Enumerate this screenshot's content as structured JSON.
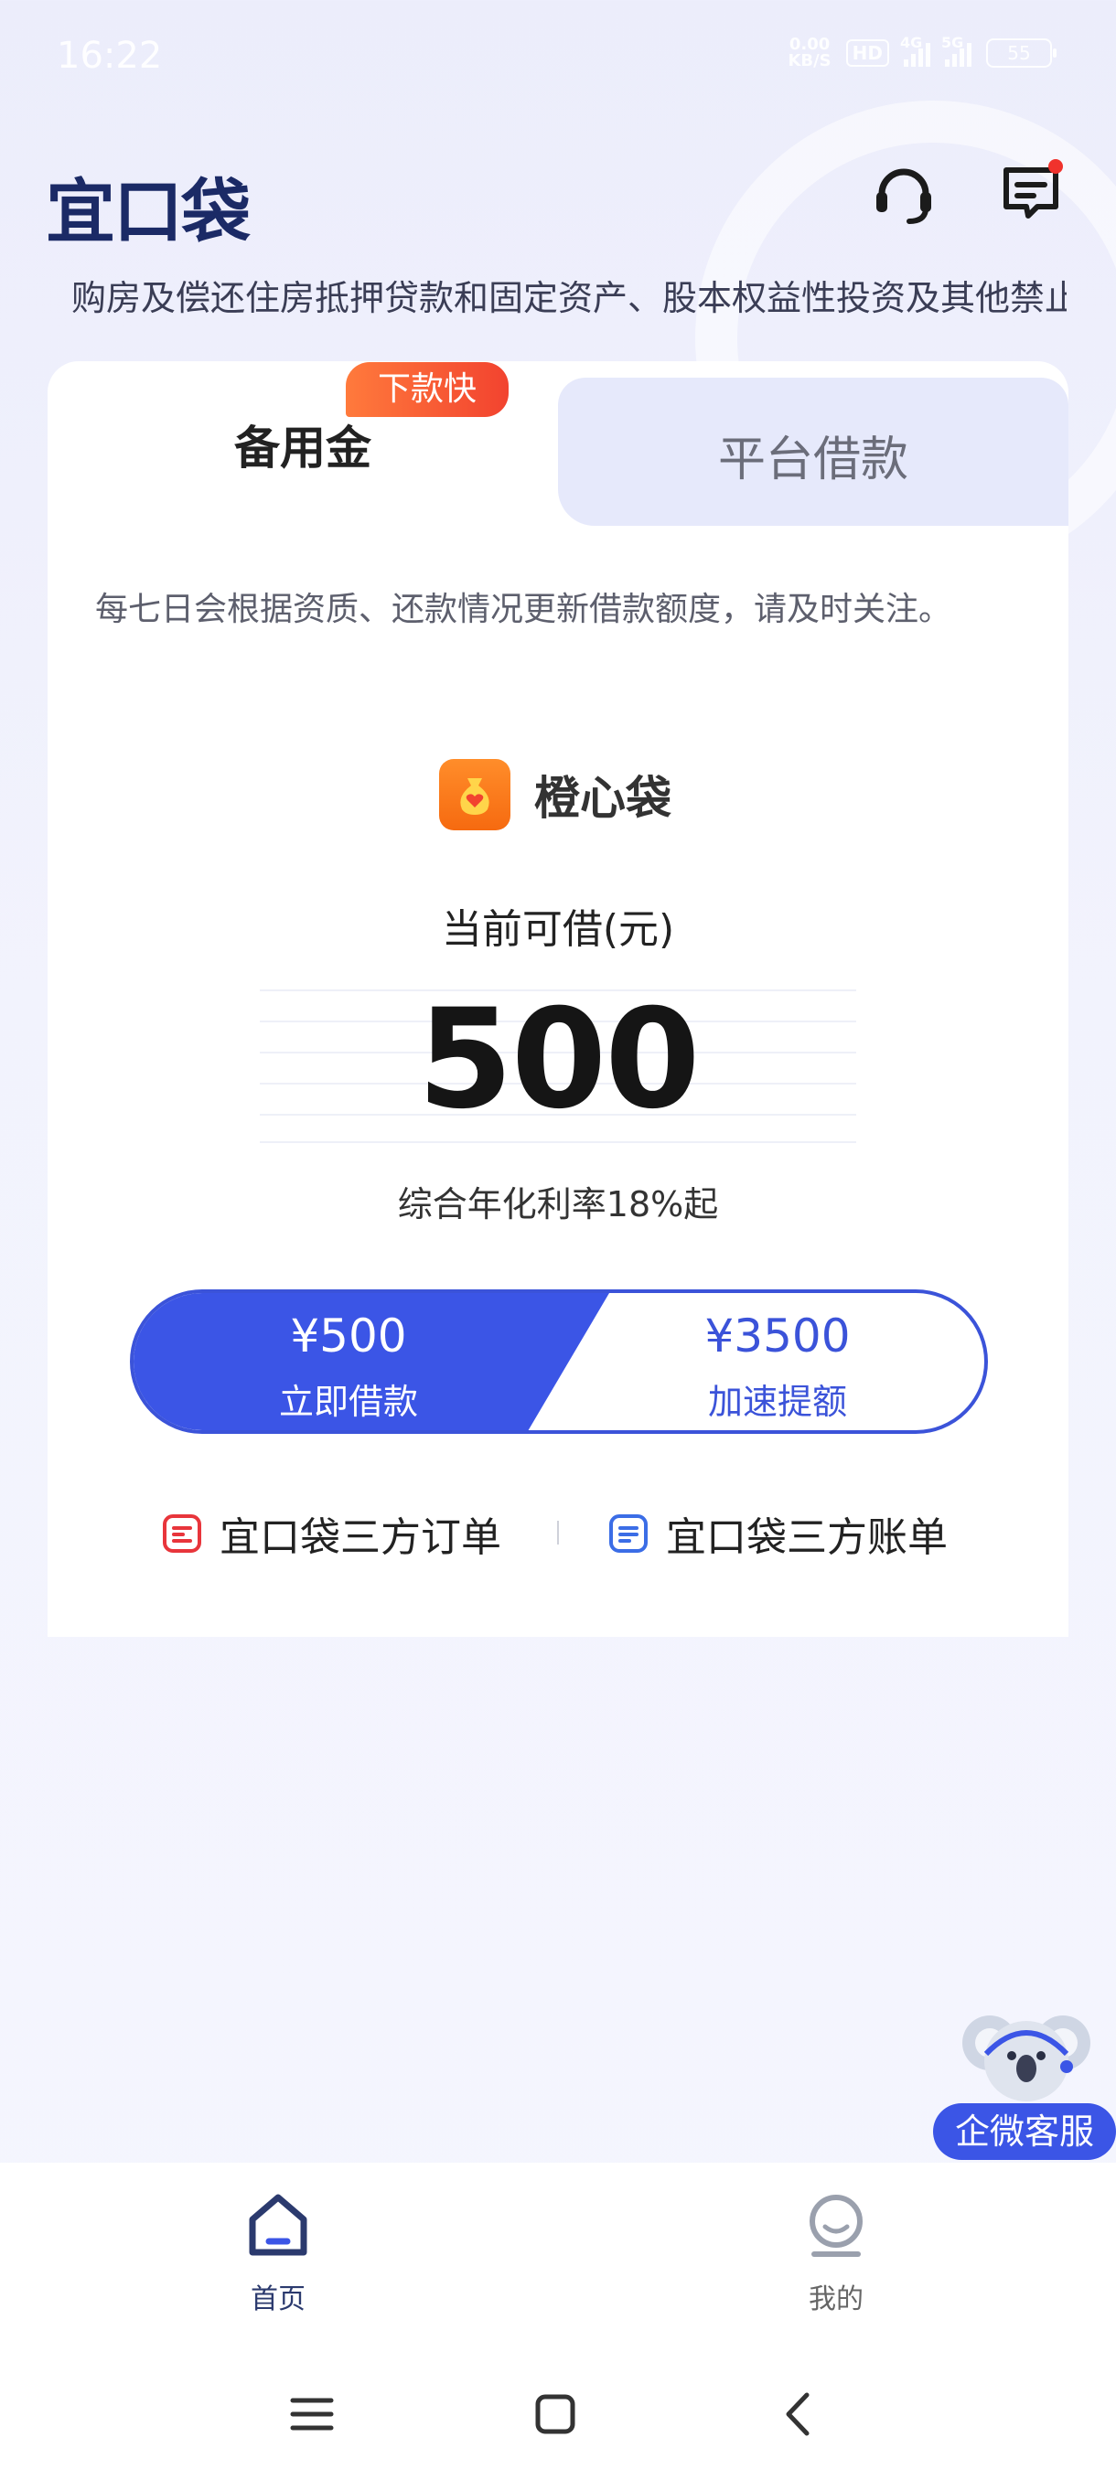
{
  "status_bar": {
    "time": "16:22",
    "net_speed_value": "0.00",
    "net_speed_unit": "KB/S",
    "hd": "HD",
    "sig1": "4G",
    "sig2": "5G",
    "battery": "55"
  },
  "header": {
    "logo": "宜口袋"
  },
  "notice": {
    "text": "购房及偿还住房抵押贷款和固定资产、股本权益性投资及其他禁止用途"
  },
  "tabs": {
    "active": "备用金",
    "inactive": "平台借款",
    "badge": "下款快"
  },
  "loan": {
    "tip": "每七日会根据资质、还款情况更新借款额度，请及时关注。",
    "brand": "橙心袋",
    "available_label": "当前可借(元)",
    "amount": "500",
    "rate": "综合年化利率18%起",
    "borrow_amount": "¥500",
    "borrow_label": "立即借款",
    "boost_amount": "¥3500",
    "boost_label": "加速提额"
  },
  "links": {
    "orders": "宜口袋三方订单",
    "bills": "宜口袋三方账单"
  },
  "service": {
    "label": "企微客服"
  },
  "bottom_nav": {
    "home": "首页",
    "mine": "我的"
  },
  "colors": {
    "primary": "#3b55e6",
    "logo": "#1b2a66",
    "badge": "#f2432f",
    "brand_orange": "#f66a10"
  }
}
